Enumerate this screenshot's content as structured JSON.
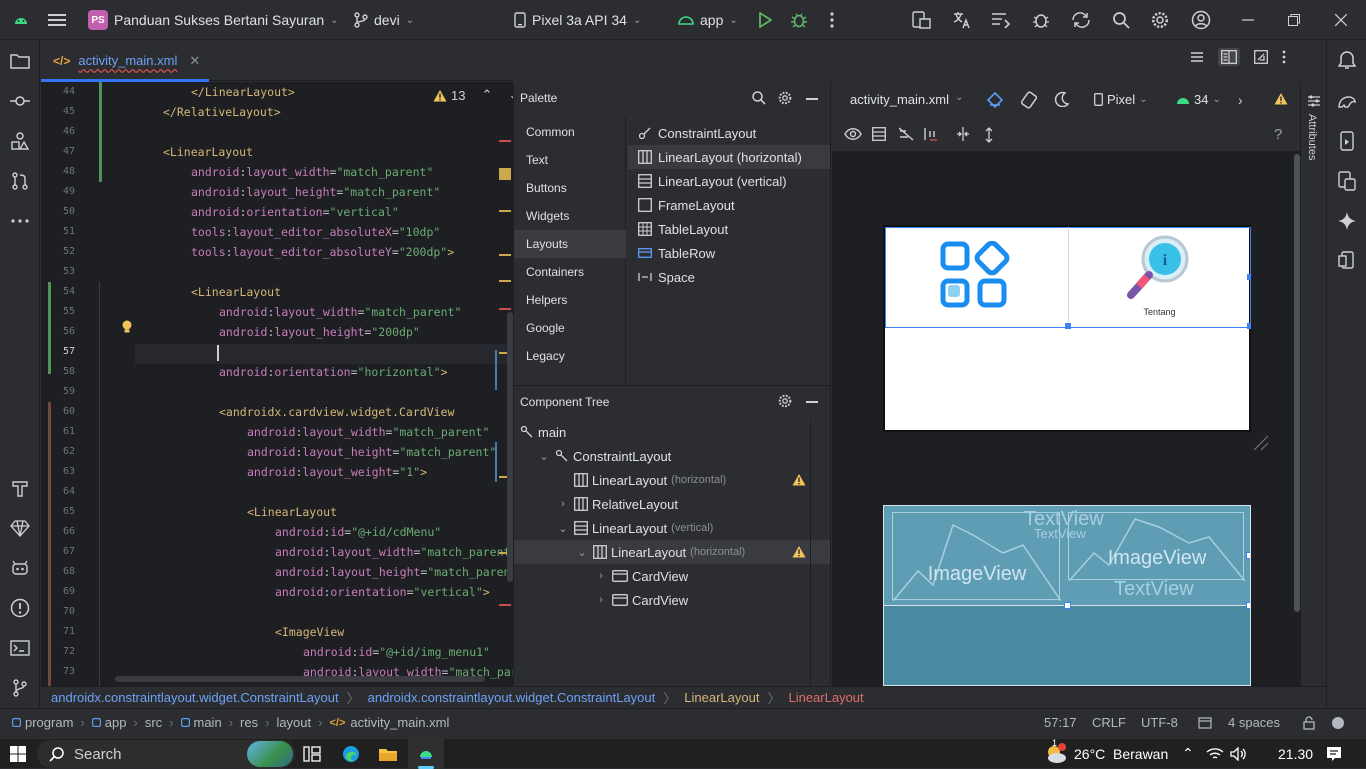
{
  "titlebar": {
    "project_badge": "PS",
    "project_name": "Panduan Sukses Bertani Sayuran",
    "branch": "devi",
    "device": "Pixel 3a API 34",
    "run_config": "app"
  },
  "tabs": [
    {
      "label": "activity_main.xml"
    }
  ],
  "editor": {
    "warnings_count": "13",
    "lines": [
      {
        "n": "44",
        "html": "<span class='tg'>&lt;/LinearLayout&gt;</span>",
        "indent": 4
      },
      {
        "n": "45",
        "html": "<span class='tg'>&lt;/RelativeLayout&gt;</span>",
        "indent": 3
      },
      {
        "n": "46",
        "html": "",
        "indent": 0
      },
      {
        "n": "47",
        "html": "<span class='tg'>&lt;LinearLayout</span>",
        "indent": 3
      },
      {
        "n": "48",
        "html": "<span class='ns'>android</span>:<span class='at'>layout_width</span>=<span class='av'>\"match_parent\"</span>",
        "indent": 4
      },
      {
        "n": "49",
        "html": "<span class='ns'>android</span>:<span class='at'>layout_height</span>=<span class='av'>\"match_parent\"</span>",
        "indent": 4
      },
      {
        "n": "50",
        "html": "<span class='ns'>android</span>:<span class='at'>orientation</span>=<span class='av'>\"vertical\"</span>",
        "indent": 4
      },
      {
        "n": "51",
        "html": "<span class='ns'>tools</span>:<span class='at'>layout_editor_absoluteX</span>=<span class='av'>\"10dp\"</span>",
        "indent": 4
      },
      {
        "n": "52",
        "html": "<span class='ns'>tools</span>:<span class='at'>layout_editor_absoluteY</span>=<span class='av'>\"200dp\"</span><span class='tg'>&gt;</span>",
        "indent": 4
      },
      {
        "n": "53",
        "html": "",
        "indent": 0
      },
      {
        "n": "54",
        "html": "<span class='tg'>&lt;LinearLayout</span>",
        "indent": 4
      },
      {
        "n": "55",
        "html": "<span class='ns'>android</span>:<span class='at'>layout_width</span>=<span class='av'>\"match_parent\"</span>",
        "indent": 5
      },
      {
        "n": "56",
        "html": "<span class='ns'>android</span>:<span class='at'>layout_height</span>=<span class='av'>\"200dp\"</span>",
        "indent": 5
      },
      {
        "n": "57",
        "html": "",
        "indent": 5
      },
      {
        "n": "58",
        "html": "<span class='ns'>android</span>:<span class='at'>orientation</span>=<span class='av'>\"horizontal\"</span><span class='tg'>&gt;</span>",
        "indent": 5
      },
      {
        "n": "59",
        "html": "",
        "indent": 0
      },
      {
        "n": "60",
        "html": "<span class='tg'>&lt;androidx.cardview.widget.CardView</span>",
        "indent": 5
      },
      {
        "n": "61",
        "html": "<span class='ns'>android</span>:<span class='at'>layout_width</span>=<span class='av'>\"match_parent\"</span>",
        "indent": 6
      },
      {
        "n": "62",
        "html": "<span class='ns'>android</span>:<span class='at'>layout_height</span>=<span class='av'>\"match_parent\"</span>",
        "indent": 6
      },
      {
        "n": "63",
        "html": "<span class='ns'>android</span>:<span class='at'>layout_weight</span>=<span class='av'>\"1\"</span><span class='tg'>&gt;</span>",
        "indent": 6
      },
      {
        "n": "64",
        "html": "",
        "indent": 0
      },
      {
        "n": "65",
        "html": "<span class='tg'>&lt;LinearLayout</span>",
        "indent": 6
      },
      {
        "n": "66",
        "html": "<span class='ns'>android</span>:<span class='at'>id</span>=<span class='av'>\"@+id/cdMenu\"</span>",
        "indent": 7
      },
      {
        "n": "67",
        "html": "<span class='ns'>android</span>:<span class='at'>layout_width</span>=<span class='av'>\"match_parent\"</span>",
        "indent": 7
      },
      {
        "n": "68",
        "html": "<span class='ns'>android</span>:<span class='at'>layout_height</span>=<span class='av'>\"match_parent\"</span>",
        "indent": 7
      },
      {
        "n": "69",
        "html": "<span class='ns'>android</span>:<span class='at'>orientation</span>=<span class='av'>\"vertical\"</span><span class='tg'>&gt;</span>",
        "indent": 7
      },
      {
        "n": "70",
        "html": "",
        "indent": 0
      },
      {
        "n": "71",
        "html": "<span class='tg'>&lt;ImageView</span>",
        "indent": 7
      },
      {
        "n": "72",
        "html": "<span class='ns'>android</span>:<span class='at'>id</span>=<span class='av'>\"@+id/img_menu1\"</span>",
        "indent": 8
      },
      {
        "n": "73",
        "html": "<span class='ns'>android</span>:<span class='at'>layout_width</span>=<span class='av'>\"match_parent\"</span>",
        "indent": 8
      }
    ]
  },
  "palette": {
    "title": "Palette",
    "categories": [
      "Common",
      "Text",
      "Buttons",
      "Widgets",
      "Layouts",
      "Containers",
      "Helpers",
      "Google",
      "Legacy"
    ],
    "selected_category": "Layouts",
    "items": [
      "ConstraintLayout",
      "LinearLayout (horizontal)",
      "LinearLayout (vertical)",
      "FrameLayout",
      "TableLayout",
      "TableRow",
      "Space"
    ]
  },
  "component_tree": {
    "title": "Component Tree",
    "rows": [
      {
        "label": "main",
        "sub": "",
        "depth": 0,
        "arrow": ""
      },
      {
        "label": "ConstraintLayout",
        "sub": "",
        "depth": 1,
        "arrow": "down"
      },
      {
        "label": "LinearLayout",
        "sub": "(horizontal)",
        "depth": 2,
        "arrow": "",
        "warn": true
      },
      {
        "label": "RelativeLayout",
        "sub": "",
        "depth": 2,
        "arrow": "right"
      },
      {
        "label": "LinearLayout",
        "sub": "(vertical)",
        "depth": 2,
        "arrow": "down"
      },
      {
        "label": "LinearLayout",
        "sub": "(horizontal)",
        "depth": 3,
        "arrow": "down",
        "warn": true,
        "selected": true
      },
      {
        "label": "CardView",
        "sub": "",
        "depth": 4,
        "arrow": "right"
      },
      {
        "label": "CardView",
        "sub": "",
        "depth": 4,
        "arrow": "right"
      }
    ]
  },
  "design": {
    "file": "activity_main.xml",
    "device": "Pixel",
    "api": "34",
    "card_label": "Tentang",
    "blueprint_labels": [
      "TextView",
      "TextView",
      "ImageView",
      "ImageView",
      "TextView"
    ]
  },
  "breadcrumb": [
    "androidx.constraintlayout.widget.ConstraintLayout",
    "androidx.constraintlayout.widget.ConstraintLayout",
    "LinearLayout",
    "LinearLayout"
  ],
  "statusbar": {
    "path": [
      "program",
      "app",
      "src",
      "main",
      "res",
      "layout",
      "activity_main.xml"
    ],
    "position": "57:17",
    "line_sep": "CRLF",
    "encoding": "UTF-8",
    "indent": "4 spaces"
  },
  "taskbar": {
    "search": "Search",
    "weather_temp": "26°C",
    "weather_desc": "Berawan",
    "time": "21.30",
    "notification_badge": "1"
  },
  "side_labels": {
    "attributes": "Attributes"
  }
}
